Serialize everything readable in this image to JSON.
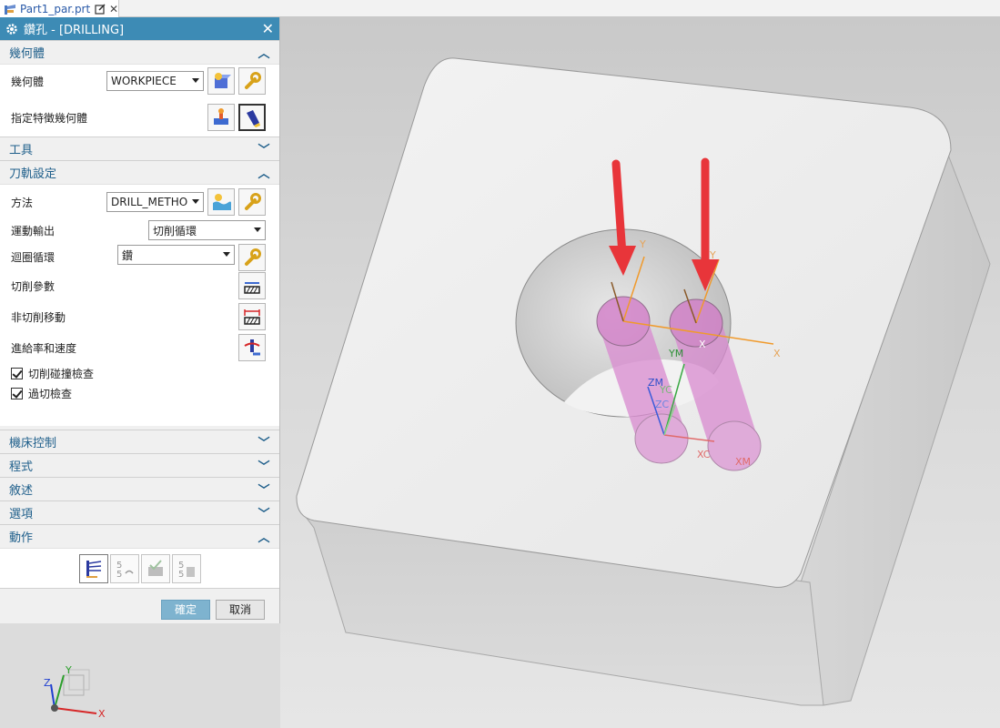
{
  "tab": {
    "label": "Part1_par.prt",
    "close": "✕"
  },
  "dialog": {
    "title": "鑽孔 - [DRILLING]",
    "close": "✕",
    "sections": {
      "geometry": {
        "header": "幾何體",
        "geometry_label": "幾何體",
        "geometry_value": "WORKPIECE",
        "feature_label": "指定特徵幾何體"
      },
      "tool": {
        "header": "工具"
      },
      "path": {
        "header": "刀軌設定",
        "method_label": "方法",
        "method_value": "DRILL_METHO",
        "motion_label": "運動輸出",
        "motion_value": "切削循環",
        "cycle_label": "迴圈循環",
        "cycle_value": "鑽",
        "cut_params_label": "切削參數",
        "non_cut_label": "非切削移動",
        "feed_label": "進給率和速度",
        "collision_label": "切削碰撞檢查",
        "gouge_label": "過切檢查"
      },
      "machine": {
        "header": "機床控制"
      },
      "program": {
        "header": "程式"
      },
      "description": {
        "header": "敘述"
      },
      "options": {
        "header": "選項"
      },
      "actions": {
        "header": "動作"
      }
    },
    "ok_label": "確定",
    "cancel_label": "取消"
  },
  "viewport": {
    "labels": {
      "x1": "X",
      "x2": "X",
      "x3": "X",
      "y1": "Y",
      "y2": "Y",
      "ym": "YM",
      "yc": "YC",
      "zm": "ZM",
      "zc": "ZC",
      "xc": "XC",
      "xm": "XM"
    },
    "triad": {
      "x": "X",
      "y": "Y",
      "z": "Z"
    }
  },
  "colors": {
    "title_bar": "#3d8bb5",
    "section_text": "#1f5f8b",
    "arrow_red": "#e8353a",
    "cylinder": "#d98ad0",
    "ok_button": "#7eb3cf"
  }
}
